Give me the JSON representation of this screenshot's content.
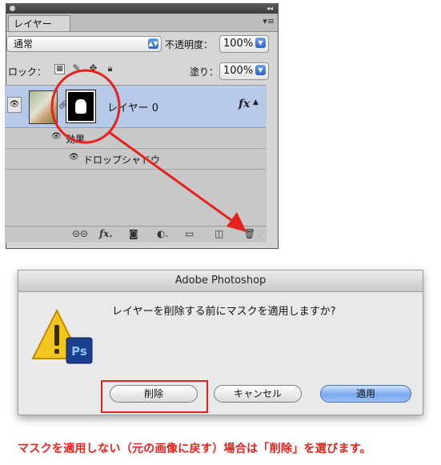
{
  "panel": {
    "tab_label": "レイヤー",
    "collapse_glyph": "◂◂",
    "menu_glyph": "▾≡",
    "blend_mode": "通常",
    "opacity_label": "不透明度：",
    "opacity_value": "100%",
    "lock_label": "ロック：",
    "lock_icons": [
      "transparency-lock-icon",
      "paint-lock-icon",
      "move-lock-icon",
      "all-lock-icon"
    ],
    "fill_label": "塗り：",
    "fill_value": "100%",
    "layer": {
      "name": "レイヤー 0",
      "fx": "fx"
    },
    "effects_label": "効果",
    "drop_shadow_label": "ドロップシャドウ",
    "bottom_icons": [
      "link-layers-icon",
      "fx-icon",
      "add-mask-icon",
      "adjustment-layer-icon",
      "new-group-icon",
      "new-layer-icon",
      "trash-icon"
    ]
  },
  "dialog": {
    "title": "Adobe Photoshop",
    "message": "レイヤーを削除する前にマスクを適用しますか?",
    "icon_badge": "Ps",
    "buttons": {
      "delete": "削除",
      "cancel": "キャンセル",
      "apply": "適用"
    }
  },
  "caption": "マスクを適用しない（元の画像に戻す）場合は「削除」を選びます。",
  "colors": {
    "annotation_red": "#e4231d",
    "selected_layer": "#b6c9e8",
    "default_button_blue": "#7aa8ee"
  }
}
